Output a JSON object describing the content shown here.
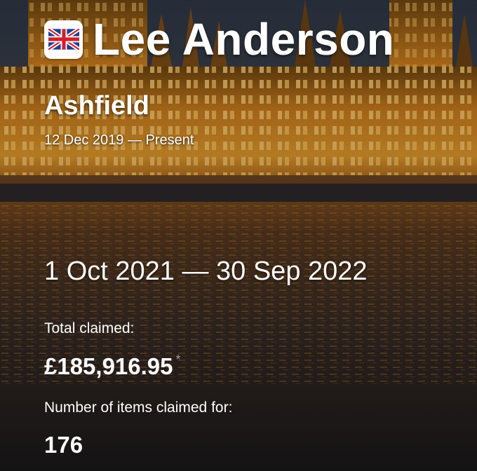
{
  "mp": {
    "name": "Lee Anderson",
    "constituency": "Ashfield",
    "tenure": "12 Dec 2019 — Present",
    "party_logo_icon": "union-flag-icon"
  },
  "expenses": {
    "period": "1 Oct 2021 — 30 Sep 2022",
    "total_claimed_label": "Total claimed:",
    "total_claimed_value": "£185,916.95",
    "total_claimed_note_marker": "*",
    "items_claimed_label": "Number of items claimed for:",
    "items_claimed_value": "176"
  },
  "colors": {
    "text": "#ffffff",
    "muted": "#9a9a9a",
    "flag_blue": "#1f3f8f",
    "flag_red": "#d0202e"
  }
}
